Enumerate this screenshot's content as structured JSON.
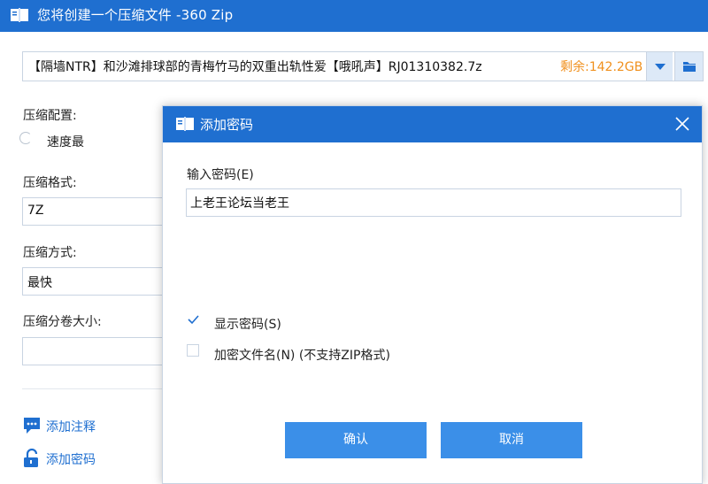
{
  "window": {
    "title": "您将创建一个压缩文件 -360 Zip"
  },
  "archive": {
    "path": "【隔墙NTR】和沙滩排球部的青梅竹马的双重出轨性爱【哦吼声】RJ01310382.7z",
    "free_space": "剩余:142.2GB"
  },
  "settings": {
    "config_label": "压缩配置:",
    "config_option": "速度最",
    "format_label": "压缩格式:",
    "format_value": "7Z",
    "method_label": "压缩方式:",
    "method_value": "最快",
    "split_label": "压缩分卷大小:",
    "split_value": ""
  },
  "links": {
    "add_comment": "添加注释",
    "add_password": "添加密码"
  },
  "dialog": {
    "title": "添加密码",
    "password_label": "输入密码(E)",
    "password_value": "上老王论坛当老王",
    "show_password": "显示密码(S)",
    "show_password_checked": true,
    "encrypt_names": "加密文件名(N) (不支持ZIP格式)",
    "encrypt_names_checked": false,
    "ok": "确认",
    "cancel": "取消"
  },
  "colors": {
    "accent": "#1f6fd0",
    "button": "#3b8fe8",
    "free_space": "#f0901d"
  }
}
